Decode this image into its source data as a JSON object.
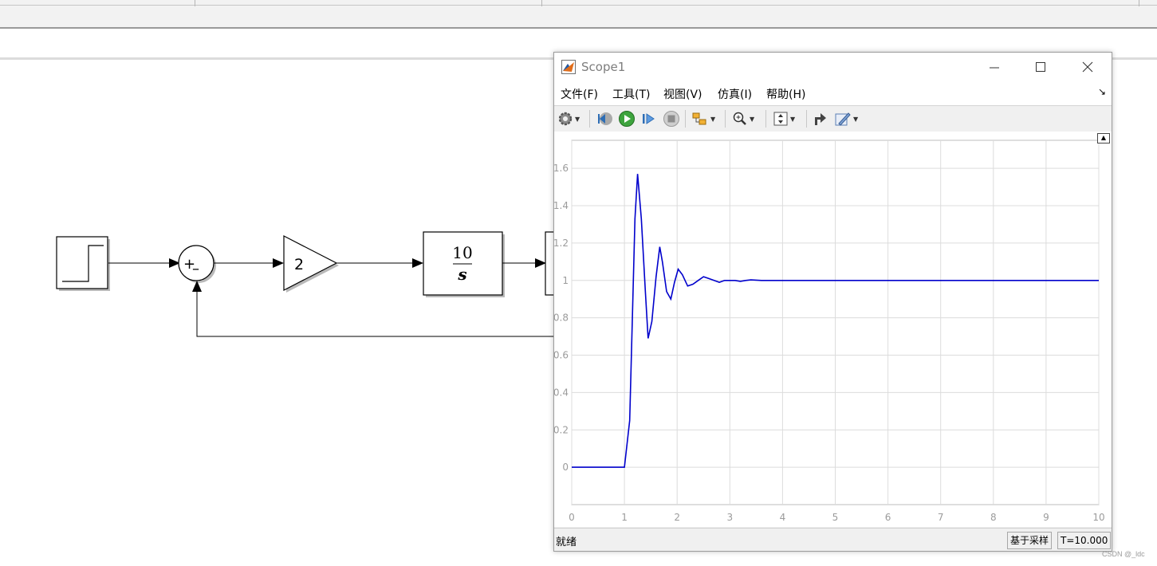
{
  "diagram": {
    "gain_value": "2",
    "integrator_numerator": "10",
    "integrator_denominator": "s",
    "sum_plus": "+",
    "sum_minus": "–"
  },
  "scope": {
    "title": "Scope1",
    "menu": [
      "文件(F)",
      "工具(T)",
      "视图(V)",
      "仿真(I)",
      "帮助(H)"
    ],
    "menu_extra": "↘",
    "toolbar_icons": [
      "gear-icon",
      "step-back-icon",
      "run-icon",
      "step-forward-icon",
      "stop-icon",
      "highlight-icon",
      "zoom-icon",
      "scale-icon",
      "restore-icon",
      "edit-icon"
    ],
    "status": "就绪",
    "sample_mode": "基于采样",
    "time": "T=10.000",
    "line_color": "#0000cc"
  },
  "chart_data": {
    "type": "line",
    "xlim": [
      0,
      10
    ],
    "ylim": [
      -0.2,
      1.75
    ],
    "xticks": [
      0,
      1,
      2,
      3,
      4,
      5,
      6,
      7,
      8,
      9,
      10
    ],
    "yticks": [
      0,
      0.2,
      0.4,
      0.6,
      0.8,
      1,
      1.2,
      1.4,
      1.6
    ],
    "xtick_labels": [
      "0",
      "1",
      "2",
      "3",
      "4",
      "5",
      "6",
      "7",
      "8",
      "9",
      "10"
    ],
    "ytick_labels": [
      "0",
      "0.2",
      "0.4",
      "0.6",
      "0.8",
      "1",
      "1.2",
      "1.4",
      "1.6"
    ],
    "grid": true,
    "series": [
      {
        "color": "#0000cc",
        "x": [
          0,
          1.0,
          1.1,
          1.2,
          1.25,
          1.32,
          1.4,
          1.45,
          1.52,
          1.6,
          1.67,
          1.72,
          1.8,
          1.88,
          1.95,
          2.02,
          2.1,
          2.2,
          2.3,
          2.4,
          2.5,
          2.6,
          2.7,
          2.8,
          2.9,
          3.0,
          3.1,
          3.2,
          3.3,
          3.4,
          3.6,
          3.8,
          4.0,
          5.0,
          6.0,
          7.0,
          8.0,
          9.0,
          10.0
        ],
        "y": [
          0,
          0,
          0.25,
          1.33,
          1.57,
          1.33,
          0.93,
          0.69,
          0.78,
          1.02,
          1.18,
          1.1,
          0.94,
          0.9,
          0.99,
          1.06,
          1.03,
          0.97,
          0.98,
          1.0,
          1.02,
          1.01,
          1.0,
          0.99,
          1.0,
          1.0,
          1.0,
          0.995,
          1.0,
          1.003,
          1.0,
          1.0,
          1.0,
          1.0,
          1.0,
          1.0,
          1.0,
          1.0,
          1.0
        ]
      }
    ]
  },
  "watermark": "CSDN @_ldc"
}
